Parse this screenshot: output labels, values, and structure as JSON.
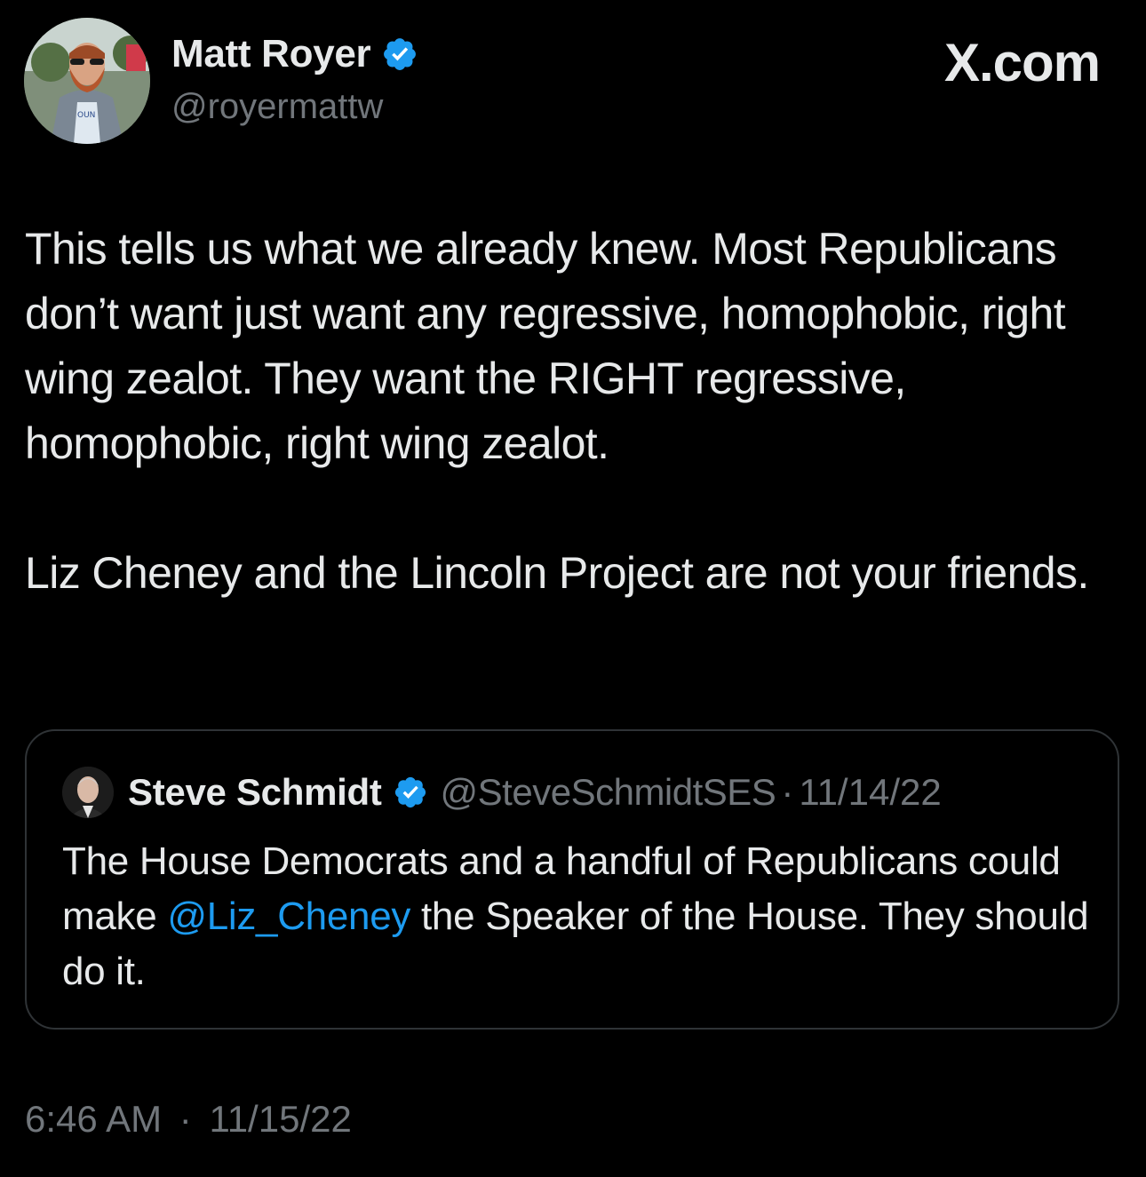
{
  "brand": {
    "text": "X.com"
  },
  "author": {
    "name": "Matt Royer",
    "handle": "@royermattw",
    "verified": true,
    "avatar_icon": "profile-photo-man-sunglasses"
  },
  "tweet": {
    "paragraph1": "This tells us what we already knew. Most Republicans don’t want just want any regressive, homophobic, right wing zealot. They want the RIGHT regressive, homophobic, right wing zealot.",
    "paragraph2": "Liz Cheney and the Lincoln Project are not your friends.",
    "time": "6:46 AM",
    "separator": "·",
    "date": "11/15/22"
  },
  "quoted_tweet": {
    "author_name": "Steve Schmidt",
    "author_handle": "@SteveSchmidtSES",
    "separator": "·",
    "date": "11/14/22",
    "verified": true,
    "text_before": "The House Democrats and a handful of Republicans could make ",
    "mention": "@Liz_Cheney",
    "text_after": " the Speaker of the House. They should do it."
  },
  "colors": {
    "background": "#000000",
    "primary_text": "#e7e9ea",
    "secondary_text": "#71767b",
    "link": "#1d9bf0",
    "verified_badge": "#1d9bf0",
    "card_border": "#2f3336"
  }
}
